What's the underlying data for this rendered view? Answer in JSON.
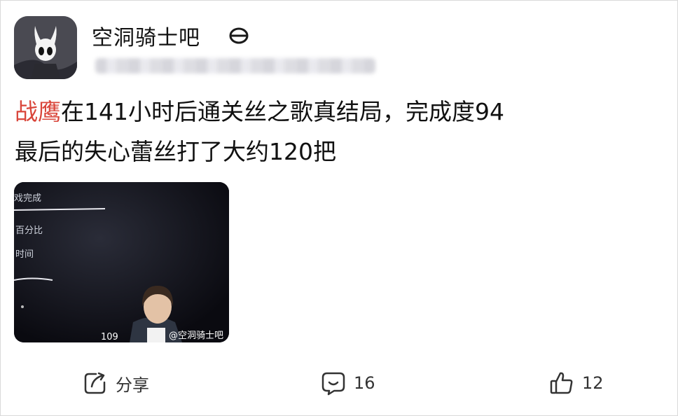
{
  "forum": {
    "name": "空洞骑士吧"
  },
  "post": {
    "mention": "战鹰",
    "line1_rest": "在141小时后通关丝之歌真结局，完成度94",
    "line2": "最后的失心蕾丝打了大约120把"
  },
  "video": {
    "overlay_texts": [
      "戏完成",
      "百分比",
      "时间"
    ],
    "viewer_count": "109",
    "watermark": "@空洞骑士吧"
  },
  "actions": {
    "share_label": "分享",
    "comment_count": "16",
    "like_count": "12"
  },
  "colors": {
    "mention": "#d9453a",
    "text": "#111111",
    "icon": "#333333"
  }
}
